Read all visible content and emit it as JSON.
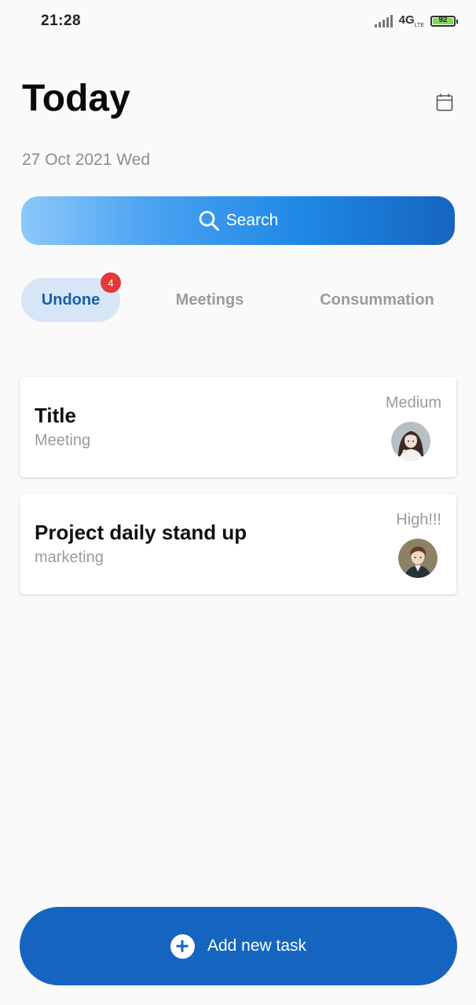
{
  "status_bar": {
    "time": "21:28",
    "network": "4G",
    "network_sub": "LTE",
    "battery": "92"
  },
  "header": {
    "title": "Today",
    "date": "27 Oct 2021 Wed",
    "calendar_icon": "calendar-icon"
  },
  "search": {
    "label": "Search",
    "icon": "search-icon",
    "gradient_start": "#8dc9f8",
    "gradient_end": "#1565c0"
  },
  "tabs": [
    {
      "label": "Undone",
      "badge": "4",
      "selected": true
    },
    {
      "label": "Meetings",
      "selected": false
    },
    {
      "label": "Consummation",
      "selected": false
    }
  ],
  "tasks": [
    {
      "title": "Title",
      "category": "Meeting",
      "priority": "Medium",
      "avatar": "female-avatar"
    },
    {
      "title": "Project daily stand up",
      "category": "marketing",
      "priority": "High!!!",
      "avatar": "male-avatar"
    }
  ],
  "add_task": {
    "label": "Add new task",
    "icon": "plus-circle-icon",
    "color": "#1565c0"
  },
  "colors": {
    "background": "#fafafa",
    "accent": "#1565c0",
    "tab_selected_bg": "#d6e6f7",
    "badge": "#e53935",
    "muted_text": "#9a9a9a"
  }
}
